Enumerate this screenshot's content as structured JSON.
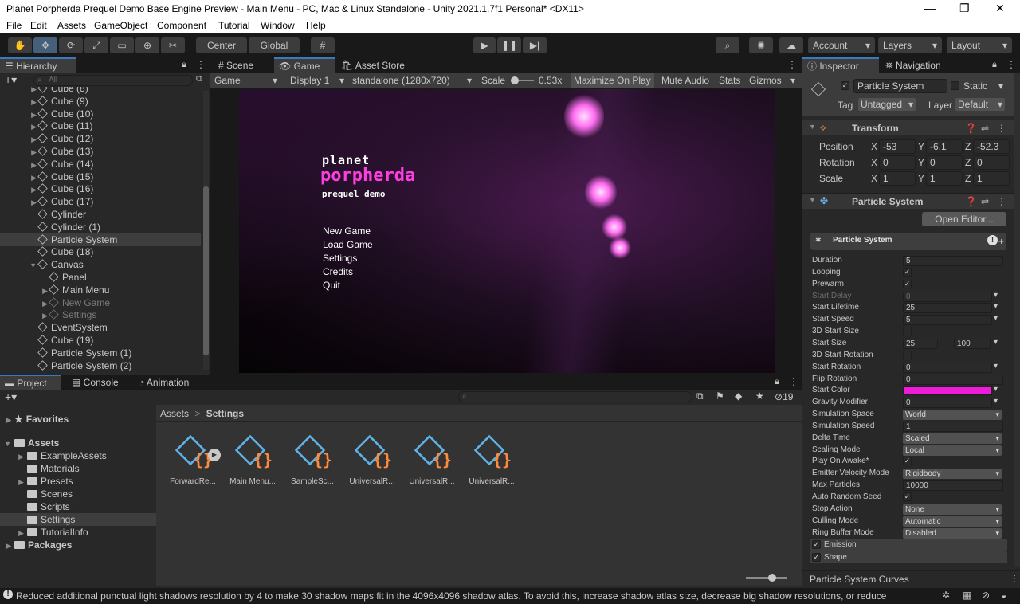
{
  "window": {
    "title": "Planet Porpherda Prequel Demo Base Engine Preview - Main Menu - PC, Mac & Linux Standalone - Unity 2021.1.7f1 Personal* <DX11>",
    "minimize": "—",
    "maximize": "❐",
    "close": "✕"
  },
  "menu": [
    "File",
    "Edit",
    "Assets",
    "GameObject",
    "Component",
    "Tutorial",
    "Window",
    "Help"
  ],
  "toolbar": {
    "pivot": "Center",
    "space": "Global",
    "account": "Account",
    "layers": "Layers",
    "layout": "Layout"
  },
  "hierarchy": {
    "tab": "Hierarchy",
    "search_placeholder": "All",
    "rows": [
      {
        "label": "Cube (8)",
        "indent": 1,
        "arrow": "▶",
        "state": ""
      },
      {
        "label": "Cube (9)",
        "indent": 1,
        "arrow": "▶",
        "state": ""
      },
      {
        "label": "Cube (10)",
        "indent": 1,
        "arrow": "▶",
        "state": ""
      },
      {
        "label": "Cube (11)",
        "indent": 1,
        "arrow": "▶",
        "state": ""
      },
      {
        "label": "Cube (12)",
        "indent": 1,
        "arrow": "▶",
        "state": ""
      },
      {
        "label": "Cube (13)",
        "indent": 1,
        "arrow": "▶",
        "state": ""
      },
      {
        "label": "Cube (14)",
        "indent": 1,
        "arrow": "▶",
        "state": ""
      },
      {
        "label": "Cube (15)",
        "indent": 1,
        "arrow": "▶",
        "state": ""
      },
      {
        "label": "Cube (16)",
        "indent": 1,
        "arrow": "▶",
        "state": ""
      },
      {
        "label": "Cube (17)",
        "indent": 1,
        "arrow": "▶",
        "state": ""
      },
      {
        "label": "Cylinder",
        "indent": 1,
        "arrow": "",
        "state": ""
      },
      {
        "label": "Cylinder (1)",
        "indent": 1,
        "arrow": "",
        "state": ""
      },
      {
        "label": "Particle System",
        "indent": 1,
        "arrow": "",
        "state": "sel"
      },
      {
        "label": "Cube (18)",
        "indent": 1,
        "arrow": "",
        "state": ""
      },
      {
        "label": "Canvas",
        "indent": 1,
        "arrow": "▼",
        "state": ""
      },
      {
        "label": "Panel",
        "indent": 2,
        "arrow": "",
        "state": ""
      },
      {
        "label": "Main Menu",
        "indent": 2,
        "arrow": "▶",
        "state": ""
      },
      {
        "label": "New Game",
        "indent": 2,
        "arrow": "▶",
        "state": "dim"
      },
      {
        "label": "Settings",
        "indent": 2,
        "arrow": "▶",
        "state": "dim"
      },
      {
        "label": "EventSystem",
        "indent": 1,
        "arrow": "",
        "state": ""
      },
      {
        "label": "Cube (19)",
        "indent": 1,
        "arrow": "",
        "state": ""
      },
      {
        "label": "Particle System (1)",
        "indent": 1,
        "arrow": "",
        "state": ""
      },
      {
        "label": "Particle System (2)",
        "indent": 1,
        "arrow": "",
        "state": ""
      }
    ]
  },
  "game": {
    "tabs": {
      "scene": "Scene",
      "game": "Game",
      "store": "Asset Store"
    },
    "bar": {
      "view": "Game",
      "display": "Display 1",
      "resolution": "standalone (1280x720)",
      "scale_label": "Scale",
      "scale_value": "0.53x",
      "maximize": "Maximize On Play",
      "mute": "Mute Audio",
      "stats": "Stats",
      "gizmos": "Gizmos"
    },
    "logo": {
      "line1": "planet",
      "line2": "porpherda",
      "line3": "prequel demo"
    },
    "menu_items": [
      "New Game",
      "Load Game",
      "Settings",
      "Credits",
      "Quit"
    ]
  },
  "project": {
    "tabs": {
      "project": "Project",
      "console": "Console",
      "animation": "Animation"
    },
    "tree": [
      {
        "label": "Favorites",
        "kind": "star",
        "indent": 0,
        "arrow": "▶",
        "bold": true
      },
      {
        "label": "Assets",
        "kind": "folder",
        "indent": 0,
        "arrow": "▼",
        "bold": true
      },
      {
        "label": "ExampleAssets",
        "kind": "folder",
        "indent": 1,
        "arrow": "▶",
        "bold": false
      },
      {
        "label": "Materials",
        "kind": "folder",
        "indent": 1,
        "arrow": "",
        "bold": false
      },
      {
        "label": "Presets",
        "kind": "folder",
        "indent": 1,
        "arrow": "▶",
        "bold": false
      },
      {
        "label": "Scenes",
        "kind": "folder",
        "indent": 1,
        "arrow": "",
        "bold": false
      },
      {
        "label": "Scripts",
        "kind": "folder",
        "indent": 1,
        "arrow": "",
        "bold": false
      },
      {
        "label": "Settings",
        "kind": "folder",
        "indent": 1,
        "arrow": "",
        "bold": false,
        "sel": true
      },
      {
        "label": "TutorialInfo",
        "kind": "folder",
        "indent": 1,
        "arrow": "▶",
        "bold": false
      },
      {
        "label": "Packages",
        "kind": "folder",
        "indent": 0,
        "arrow": "▶",
        "bold": true
      }
    ],
    "breadcrumb": {
      "root": "Assets",
      "sep": ">",
      "current": "Settings"
    },
    "hidden_count": "19",
    "assets": [
      "ForwardRe...",
      "Main Menu...",
      "SampleSc...",
      "UniversalR...",
      "UniversalR...",
      "UniversalR..."
    ]
  },
  "inspector": {
    "tabs": {
      "inspector": "Inspector",
      "navigation": "Navigation"
    },
    "object": {
      "name": "Particle System",
      "static": "Static",
      "tag_label": "Tag",
      "tag": "Untagged",
      "layer_label": "Layer",
      "layer": "Default"
    },
    "transform": {
      "title": "Transform",
      "rows": [
        {
          "label": "Position",
          "x": "-53",
          "y": "-6.1",
          "z": "-52.3"
        },
        {
          "label": "Rotation",
          "x": "0",
          "y": "0",
          "z": "0"
        },
        {
          "label": "Scale",
          "x": "1",
          "y": "1",
          "z": "1"
        }
      ],
      "axes": {
        "x": "X",
        "y": "Y",
        "z": "Z"
      }
    },
    "ps": {
      "title": "Particle System",
      "open_editor": "Open Editor...",
      "module": "Particle System",
      "rows": [
        {
          "label": "Duration",
          "type": "field",
          "value": "5"
        },
        {
          "label": "Looping",
          "type": "check",
          "value": "✓"
        },
        {
          "label": "Prewarm",
          "type": "check",
          "value": "✓"
        },
        {
          "label": "Start Delay",
          "type": "fielddrop",
          "value": "0",
          "dim": true
        },
        {
          "label": "Start Lifetime",
          "type": "fielddrop",
          "value": "25"
        },
        {
          "label": "Start Speed",
          "type": "fielddrop",
          "value": "5"
        },
        {
          "label": "3D Start Size",
          "type": "check",
          "value": ""
        },
        {
          "label": "Start Size",
          "type": "range",
          "value": "25",
          "value2": "100"
        },
        {
          "label": "3D Start Rotation",
          "type": "check",
          "value": ""
        },
        {
          "label": "Start Rotation",
          "type": "fielddrop",
          "value": "0"
        },
        {
          "label": "Flip Rotation",
          "type": "field",
          "value": "0"
        },
        {
          "label": "Start Color",
          "type": "color",
          "value": "#ee1bd8"
        },
        {
          "label": "Gravity Modifier",
          "type": "fielddrop",
          "value": "0"
        },
        {
          "label": "Simulation Space",
          "type": "drop",
          "value": "World"
        },
        {
          "label": "Simulation Speed",
          "type": "field",
          "value": "1"
        },
        {
          "label": "Delta Time",
          "type": "drop",
          "value": "Scaled"
        },
        {
          "label": "Scaling Mode",
          "type": "drop",
          "value": "Local"
        },
        {
          "label": "Play On Awake*",
          "type": "check",
          "value": "✓"
        },
        {
          "label": "Emitter Velocity Mode",
          "type": "drop",
          "value": "Rigidbody"
        },
        {
          "label": "Max Particles",
          "type": "field",
          "value": "10000"
        },
        {
          "label": "Auto Random Seed",
          "type": "check",
          "value": "✓"
        },
        {
          "label": "Stop Action",
          "type": "drop",
          "value": "None"
        },
        {
          "label": "Culling Mode",
          "type": "drop",
          "value": "Automatic"
        },
        {
          "label": "Ring Buffer Mode",
          "type": "drop",
          "value": "Disabled"
        }
      ],
      "modules": [
        "Emission",
        "Shape"
      ],
      "curves": "Particle System Curves"
    }
  },
  "status": {
    "message": "Reduced additional punctual light shadows resolution by 4 to make 30 shadow maps fit in the 4096x4096 shadow atlas. To avoid this, increase shadow atlas size, decrease big shadow resolutions, or reduce"
  },
  "colors": {
    "accent": "#3a79bb",
    "selection": "#46607c",
    "start_color": "#ee1bd8",
    "logo_pink": "#ff3ee0"
  }
}
